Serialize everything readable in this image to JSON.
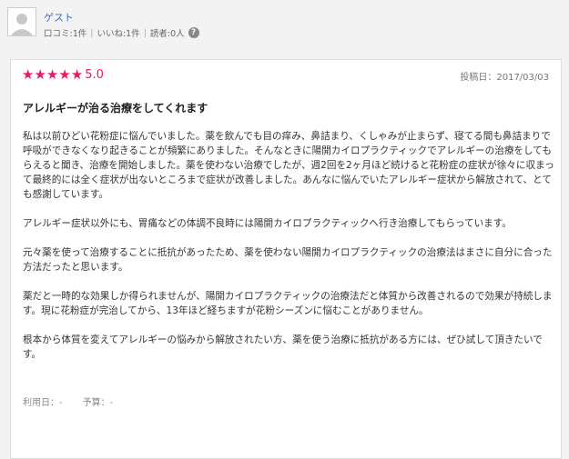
{
  "user": {
    "name": "ゲスト",
    "reviews": "口コミ:1件",
    "likes": "いいね:1件",
    "readers": "読者:0人"
  },
  "review": {
    "rating": "5.0",
    "stars": 5,
    "date": "投稿日：2017/03/03",
    "title": "アレルギーが治る治療をしてくれます",
    "paragraphs": [
      "私は以前ひどい花粉症に悩んでいました。薬を飲んでも目の痒み、鼻詰まり、くしゃみが止まらず、寝てる間も鼻詰まりで呼吸ができなくなり起きることが頻繁にありました。そんなときに陽開カイロプラクティックでアレルギーの治療をしてもらえると聞き、治療を開始しました。薬を使わない治療でしたが、週2回を2ヶ月ほど続けると花粉症の症状が徐々に収まって最終的には全く症状が出ないところまで症状が改善しました。あんなに悩んでいたアレルギー症状から解放されて、とても感謝しています。",
      "アレルギー症状以外にも、胃痛などの体調不良時には陽開カイロプラクティックへ行き治療してもらっています。",
      "元々薬を使って治療することに抵抗があったため、薬を使わない陽開カイロプラクティックの治療法はまさに自分に合った方法だったと思います。",
      "薬だと一時的な効果しか得られませんが、陽開カイロプラクティックの治療法だと体質から改善されるので効果が持続します。現に花粉症が完治してから、13年ほど経ちますが花粉シーズンに悩むことがありません。",
      "根本から体質を変えてアレルギーの悩みから解放されたい方、薬を使う治療に抵抗がある方には、ぜひ試して頂きたいです。"
    ],
    "usage": "利用日：-",
    "budget": "予算：-"
  },
  "colors": {
    "accent": "#e8196a",
    "link": "#3a6fb7"
  },
  "icons": {
    "help": "question-circle-icon",
    "avatar": "user-avatar-icon",
    "star": "star-icon"
  }
}
